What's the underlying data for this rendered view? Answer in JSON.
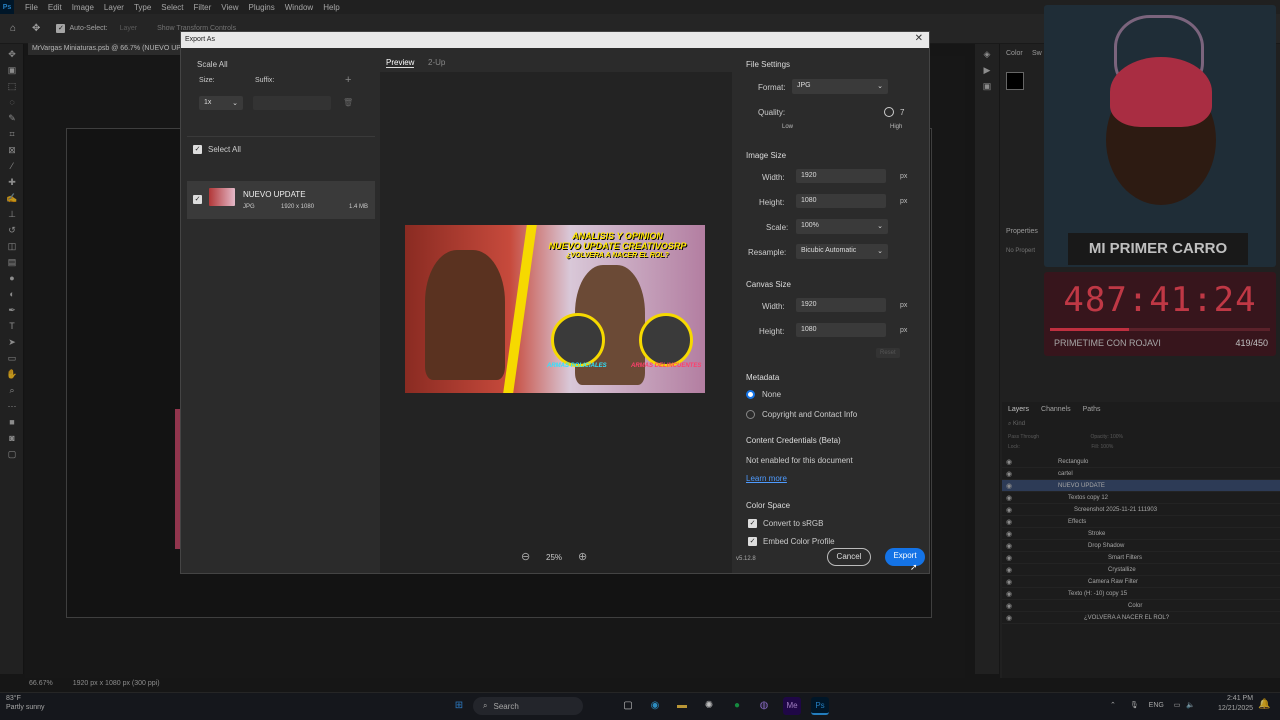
{
  "menubar": {
    "items": [
      "File",
      "Edit",
      "Image",
      "Layer",
      "Type",
      "Select",
      "Filter",
      "View",
      "Plugins",
      "Window",
      "Help"
    ]
  },
  "options": {
    "auto_select": "Auto-Select:",
    "layer": "Layer",
    "transform": "Show Transform Controls"
  },
  "document": {
    "tab_title": "MrVargas Miniaturas.psb @ 66.7% (NUEVO UP"
  },
  "status": {
    "zoom": "66.67%",
    "doc_info": "1920 px x 1080 px (300 ppi)"
  },
  "panels": {
    "color_tab": "Color",
    "swatches_tab": "Sw",
    "properties": "Properties",
    "no_properties": "No Propert"
  },
  "layers_panel": {
    "tabs": [
      "Layers",
      "Channels",
      "Paths"
    ],
    "kind": "Kind",
    "blend": "Pass Through",
    "opacity_label": "Opacity:",
    "opacity": "100%",
    "lock": "Lock:",
    "fill_label": "Fill:",
    "fill": "100%",
    "rows": [
      {
        "name": "Rectangulo",
        "indent": 40
      },
      {
        "name": "cartel",
        "indent": 40
      },
      {
        "name": "NUEVO UPDATE",
        "indent": 40,
        "selected": true
      },
      {
        "name": "Textos copy 12",
        "indent": 50
      },
      {
        "name": "Screenshot 2025-11-21 111903",
        "indent": 56
      },
      {
        "name": "Effects",
        "indent": 50
      },
      {
        "name": "Stroke",
        "indent": 70
      },
      {
        "name": "Drop Shadow",
        "indent": 70
      },
      {
        "name": "Smart Filters",
        "indent": 90
      },
      {
        "name": "Crystallize",
        "indent": 90
      },
      {
        "name": "Camera Raw Filter",
        "indent": 70
      },
      {
        "name": "Texto (H: -10) copy 15",
        "indent": 50
      },
      {
        "name": "Color",
        "indent": 110
      },
      {
        "name": "¿VOLVERA A NACER EL ROL?",
        "indent": 66
      }
    ]
  },
  "stream": {
    "sign": "MI PRIMER CARRO",
    "timer": "487:41:24",
    "timer_label": "PRIMETIME CON ROJAVI",
    "counter": "419/450",
    "progress": 0.36
  },
  "dialog": {
    "title": "Export As",
    "scale_all": "Scale All",
    "size_label": "Size:",
    "suffix_label": "Suffix:",
    "scale_value": "1x",
    "select_all": "Select All",
    "asset_name": "NUEVO UPDATE",
    "asset_format": "JPG",
    "asset_dims": "1920 x 1080",
    "asset_size": "1.4 MB",
    "tab_preview": "Preview",
    "tab_2up": "2-Up",
    "zoom": "25%",
    "thumbnail": {
      "line1": "ANALISIS Y OPINION",
      "line2": "NUEVO UPDATE CREATIVOSRP",
      "line3": "¿VOLVERA A NACER EL ROL?",
      "cap1": "ARMAS POLICIALES",
      "cap2": "ARMAS DELINCUENTES"
    },
    "file_settings": "File Settings",
    "format_label": "Format:",
    "format_value": "JPG",
    "quality_label": "Quality:",
    "quality_value": "7",
    "quality_low": "Low",
    "quality_high": "High",
    "image_size": "Image Size",
    "width_label": "Width:",
    "height_label": "Height:",
    "img_width": "1920",
    "img_height": "1080",
    "unit": "px",
    "scale_label": "Scale:",
    "scale_pct": "100%",
    "resample_label": "Resample:",
    "resample_value": "Bicubic Automatic",
    "canvas_size": "Canvas Size",
    "canvas_width": "1920",
    "canvas_height": "1080",
    "reset": "Reset",
    "metadata": "Metadata",
    "meta_none": "None",
    "meta_copyright": "Copyright and Contact Info",
    "content_credentials": "Content Credentials (Beta)",
    "not_enabled": "Not enabled for this document",
    "learn_more": "Learn more",
    "color_space": "Color Space",
    "convert_srgb": "Convert to sRGB",
    "embed_profile": "Embed Color Profile",
    "version": "v5.12.8",
    "cancel": "Cancel",
    "export": "Export"
  },
  "taskbar": {
    "temp": "83°F",
    "weather": "Partly sunny",
    "search": "Search",
    "lang": "ENG",
    "time": "2:41 PM",
    "date": "12/21/2025"
  },
  "colors": {
    "accent": "#1473e6",
    "timer_red": "#ff4b5c"
  }
}
